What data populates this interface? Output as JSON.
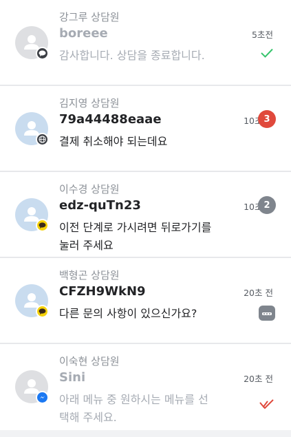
{
  "theme": {
    "unread_red": "#e0493c",
    "unread_gray": "#7f858d",
    "check_green": "#35c46b",
    "check_red": "#e0493c"
  },
  "chats": [
    {
      "agent": "강그루 상담원",
      "customer": "boreee",
      "time": "5초전",
      "message": "감사합니다. 상담을 종료합니다.",
      "channel_icon": "talk-bubble-icon",
      "status": "read-check-icon"
    },
    {
      "agent": "김지영 상담원",
      "customer": "79a44488eaae",
      "time": "10초 전",
      "message": "결제 취소해야 되는데요",
      "channel_icon": "globe-icon",
      "unread": "3"
    },
    {
      "agent": "이수경 상담원",
      "customer": "edz-quTn23",
      "time": "10초 전",
      "message": "이전 단계로 가시려면 뒤로가기를 눌러 주세요",
      "channel_icon": "talk-bubble-icon",
      "unread": "2"
    },
    {
      "agent": "백형곤 상담원",
      "customer": "CFZH9WkN9",
      "time": "20초 전",
      "message": "다른 문의 사항이 있으신가요?",
      "channel_icon": "talk-bubble-icon",
      "status": "typing-bubble-icon"
    },
    {
      "agent": "이숙현 상담원",
      "customer": "Sini",
      "time": "20초 전",
      "message": "아래 메뉴 중 원하시는 메뉴를 선택해 주세요.",
      "channel_icon": "messenger-icon",
      "status": "double-check-icon"
    }
  ]
}
